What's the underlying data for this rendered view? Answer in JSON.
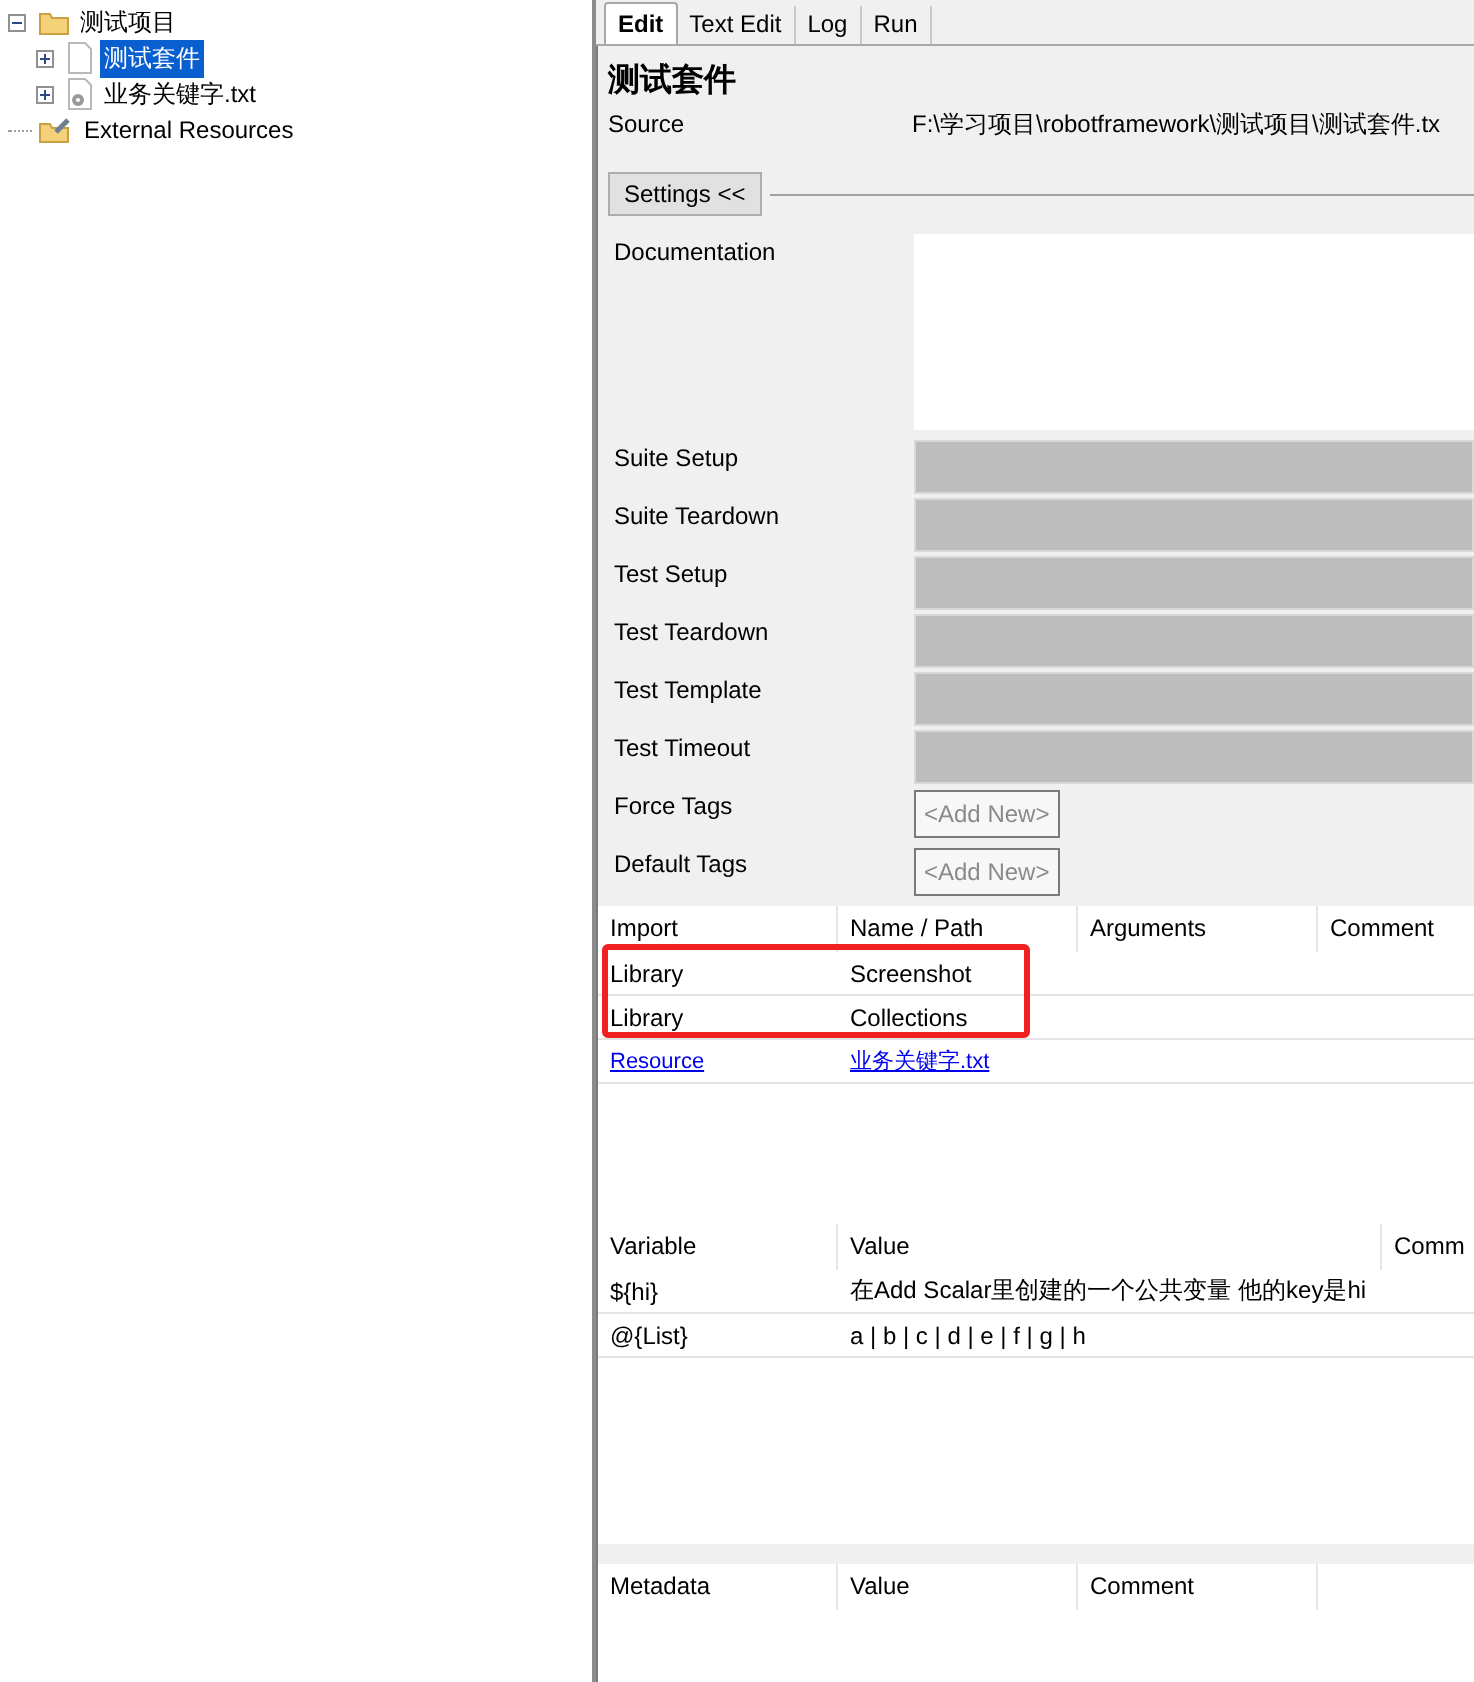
{
  "tree": [
    {
      "label": "测试项目",
      "kind": "folder",
      "expandable": true,
      "expanded": true,
      "selected": false,
      "children": [
        {
          "label": "测试套件",
          "kind": "suite",
          "expandable": true,
          "expanded": false,
          "selected": true
        },
        {
          "label": "业务关键字.txt",
          "kind": "resource",
          "expandable": true,
          "expanded": false,
          "selected": false
        }
      ]
    },
    {
      "label": "External Resources",
      "kind": "external",
      "expandable": false,
      "expanded": false,
      "selected": false
    }
  ],
  "tabs": [
    {
      "label": "Edit",
      "selected": true
    },
    {
      "label": "Text Edit",
      "selected": false
    },
    {
      "label": "Log",
      "selected": false
    },
    {
      "label": "Run",
      "selected": false
    }
  ],
  "title": "测试套件",
  "source": {
    "label": "Source",
    "value": "F:\\学习项目\\robotframework\\测试项目\\测试套件.tx"
  },
  "settings_button": "Settings <<",
  "settings": [
    {
      "label": "Documentation",
      "kind": "documentation"
    },
    {
      "label": "Suite Setup",
      "kind": "keyword"
    },
    {
      "label": "Suite Teardown",
      "kind": "keyword"
    },
    {
      "label": "Test Setup",
      "kind": "keyword"
    },
    {
      "label": "Test Teardown",
      "kind": "keyword"
    },
    {
      "label": "Test Template",
      "kind": "keyword"
    },
    {
      "label": "Test Timeout",
      "kind": "keyword"
    },
    {
      "label": "Force Tags",
      "kind": "tags",
      "placeholder": "<Add New>"
    },
    {
      "label": "Default Tags",
      "kind": "tags",
      "placeholder": "<Add New>"
    }
  ],
  "imports": {
    "columns": [
      "Import",
      "Name / Path",
      "Arguments",
      "Comment"
    ],
    "rows": [
      {
        "linked": false,
        "cells": [
          "Library",
          "Screenshot"
        ]
      },
      {
        "linked": false,
        "cells": [
          "Library",
          "Collections"
        ]
      },
      {
        "linked": true,
        "cells": [
          "Resource",
          "业务关键字.txt"
        ]
      }
    ]
  },
  "variables": {
    "columns": [
      "Variable",
      "Value",
      "Comm"
    ],
    "rows": [
      {
        "cells": [
          "${hi}",
          "在Add Scalar里创建的一个公共变量 他的key是hi"
        ]
      },
      {
        "cells": [
          "@{List}",
          "a | b | c | d | e | f | g | h"
        ]
      }
    ]
  },
  "metadata": {
    "columns": [
      "Metadata",
      "Value",
      "Comment"
    ]
  }
}
